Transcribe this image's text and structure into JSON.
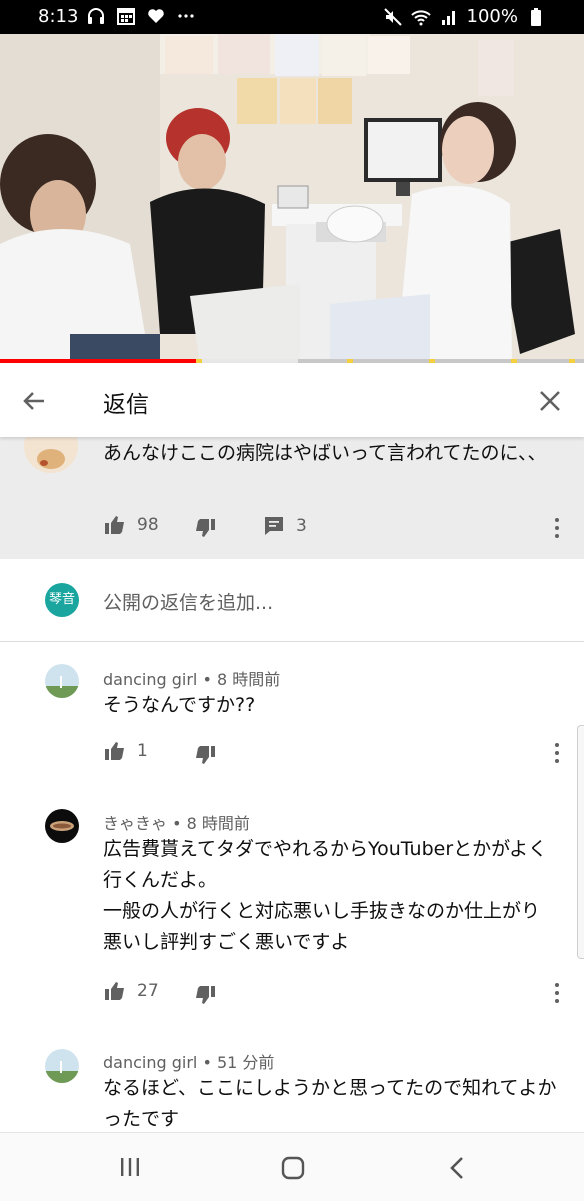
{
  "status_bar": {
    "time": "8:13",
    "battery": "100%",
    "left_icons": [
      "headphones-icon",
      "calendar-icon",
      "heart-icon",
      "more-dots-icon"
    ],
    "right_icons": [
      "mute-icon",
      "wifi-icon",
      "signal-icon",
      "battery-icon"
    ]
  },
  "video": {
    "progress_played": 0.34,
    "progress_buffered": 0.51,
    "chapter_marks": [
      0.34,
      0.6,
      0.74,
      0.88,
      0.98
    ]
  },
  "header": {
    "title": "返信",
    "back_icon": "arrow-left-icon",
    "close_icon": "close-icon"
  },
  "parent_comment": {
    "text": "あんなけここの病院はやばいって言われてたのに、、",
    "likes": "98",
    "replies": "3"
  },
  "add_reply": {
    "avatar_label": "琴音",
    "placeholder": "公開の返信を追加..."
  },
  "replies": [
    {
      "author": "dancing girl",
      "time": "8 時間前",
      "text": "そうなんですか??",
      "likes": "1"
    },
    {
      "author": "きゃきゃ",
      "time": "8 時間前",
      "text": "広告費貰えてタダでやれるからYouTuberとかがよく行くんだよ。\n一般の人が行くと対応悪いし手抜きなのか仕上がり悪いし評判すごく悪いですよ",
      "likes": "27"
    },
    {
      "author": "dancing girl",
      "time": "51 分前",
      "text": "なるほど、ここにしようかと思ってたので知れてよかったです",
      "likes": ""
    }
  ],
  "nav_bar": {
    "icons": [
      "recent-apps-icon",
      "home-icon",
      "back-icon"
    ]
  },
  "colors": {
    "accent_red": "#ff0000",
    "avatar_teal": "#1aa59f",
    "parent_bg": "#ececec",
    "secondary_text": "#606060"
  }
}
